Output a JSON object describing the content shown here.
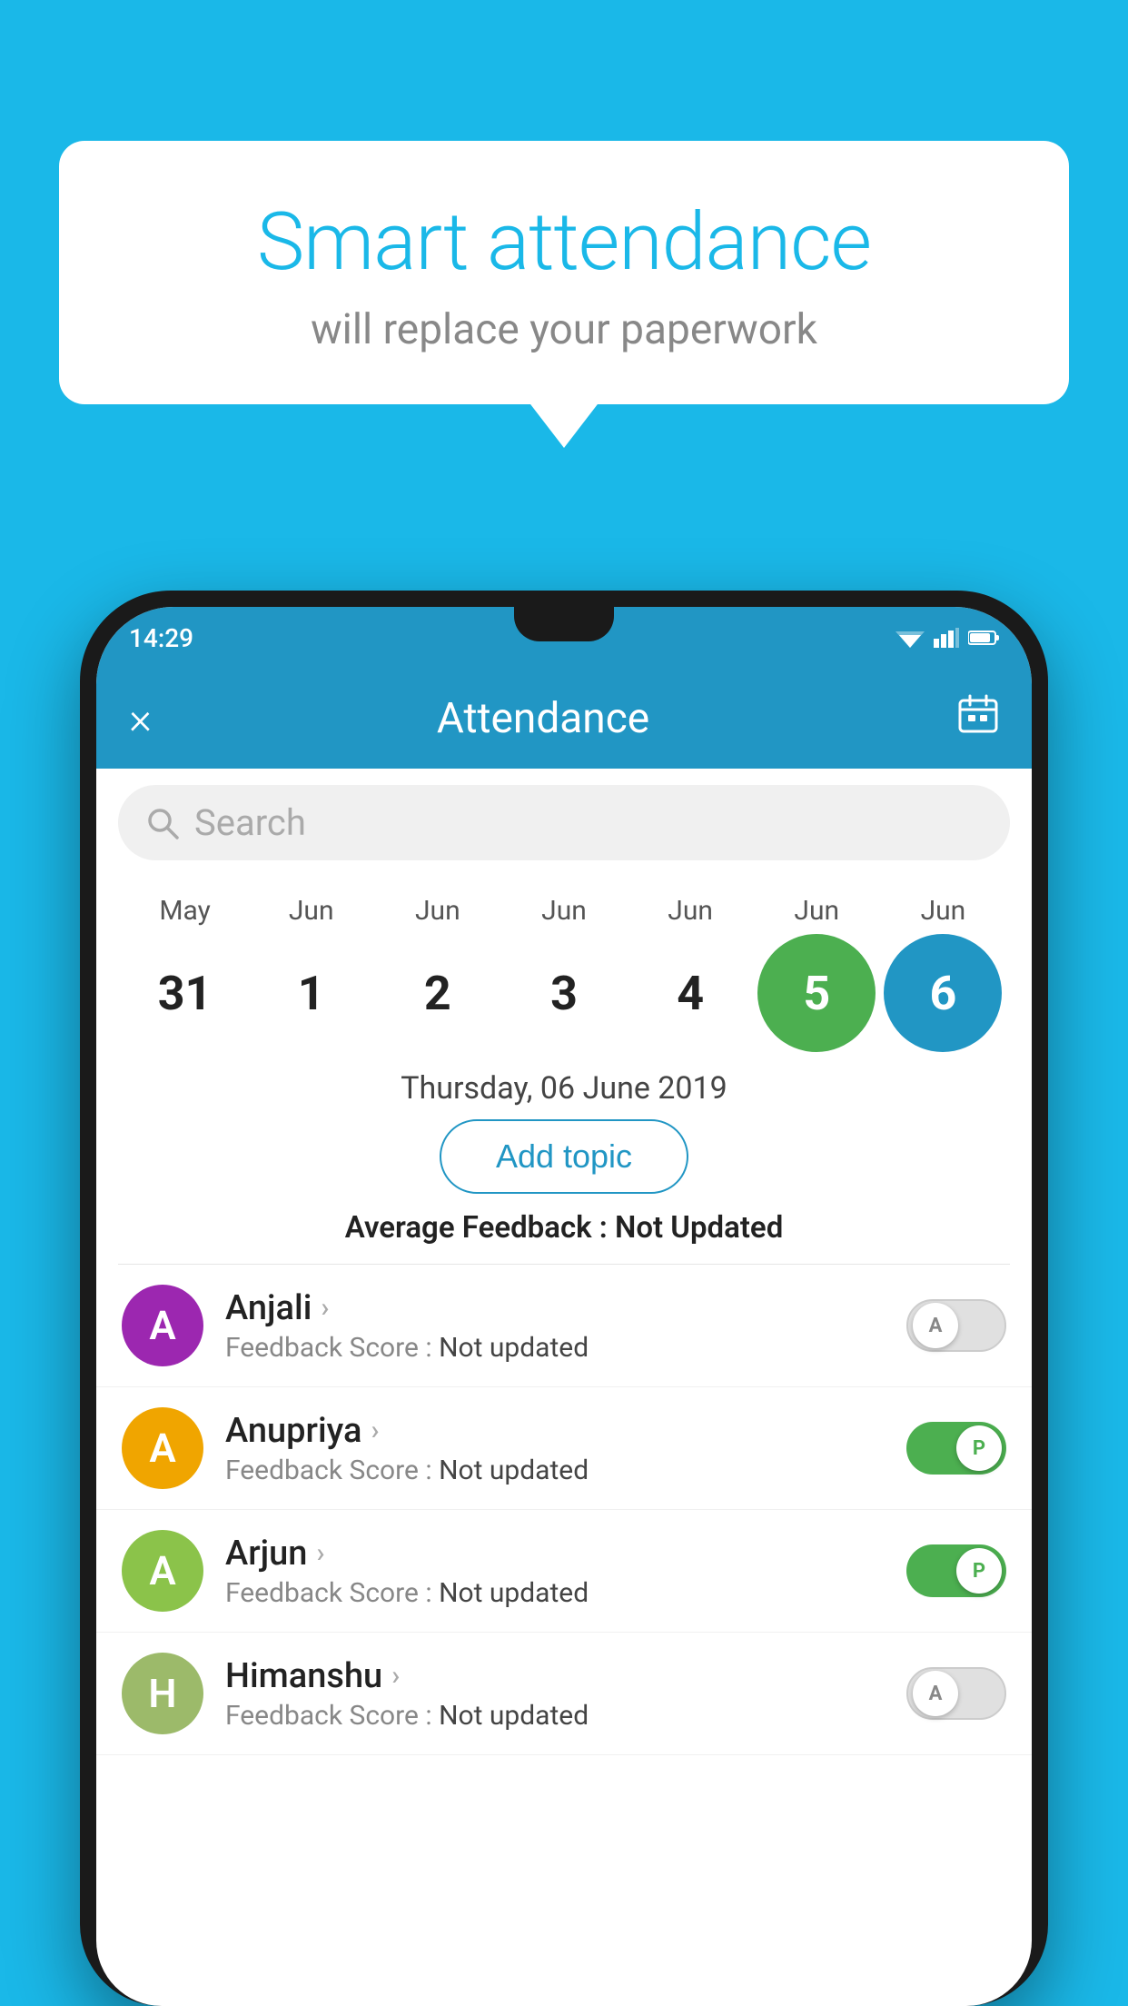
{
  "background_color": "#1ab8e8",
  "speech_bubble": {
    "title": "Smart attendance",
    "subtitle": "will replace your paperwork"
  },
  "status_bar": {
    "time": "14:29"
  },
  "app_bar": {
    "title": "Attendance",
    "close_label": "×",
    "calendar_label": "📅"
  },
  "search": {
    "placeholder": "Search"
  },
  "calendar": {
    "months": [
      "May",
      "Jun",
      "Jun",
      "Jun",
      "Jun",
      "Jun",
      "Jun"
    ],
    "dates": [
      "31",
      "1",
      "2",
      "3",
      "4",
      "5",
      "6"
    ],
    "today_index": 5,
    "selected_index": 6
  },
  "date_label": "Thursday, 06 June 2019",
  "add_topic_label": "Add topic",
  "avg_feedback": {
    "label": "Average Feedback : ",
    "value": "Not Updated"
  },
  "students": [
    {
      "name": "Anjali",
      "avatar_letter": "A",
      "avatar_color": "#9c27b0",
      "score_label": "Feedback Score : ",
      "score_value": "Not updated",
      "toggle": "off",
      "toggle_letter": "A"
    },
    {
      "name": "Anupriya",
      "avatar_letter": "A",
      "avatar_color": "#f0a500",
      "score_label": "Feedback Score : ",
      "score_value": "Not updated",
      "toggle": "on",
      "toggle_letter": "P"
    },
    {
      "name": "Arjun",
      "avatar_letter": "A",
      "avatar_color": "#8bc34a",
      "score_label": "Feedback Score : ",
      "score_value": "Not updated",
      "toggle": "on",
      "toggle_letter": "P"
    },
    {
      "name": "Himanshu",
      "avatar_letter": "H",
      "avatar_color": "#9cba6a",
      "score_label": "Feedback Score : ",
      "score_value": "Not updated",
      "toggle": "off",
      "toggle_letter": "A"
    }
  ]
}
